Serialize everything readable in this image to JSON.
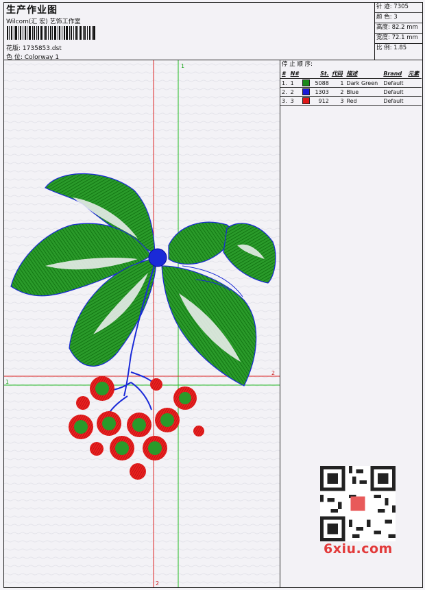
{
  "header": {
    "title": "生产作业图",
    "company": "Wilcom(汇 宏) 艺饰工作室",
    "design_label": "花版:",
    "design_file": "1735853.dst",
    "colorway_label": "色 位:",
    "colorway": "Colorway 1"
  },
  "stats": [
    {
      "label": "针 迹:",
      "value": "7305"
    },
    {
      "label": "颜 色:",
      "value": "3"
    },
    {
      "label": "高度:",
      "value": "82.2 mm"
    },
    {
      "label": "宽度:",
      "value": "72.1 mm"
    },
    {
      "label": "比 例:",
      "value": "1.85"
    }
  ],
  "stop_sequence": {
    "title": "停 止 顺 序:",
    "columns": [
      "#",
      "N#",
      "St.",
      "代码",
      "描述",
      "Brand",
      "元素"
    ],
    "rows": [
      {
        "index": "1.",
        "n": "1",
        "stitches": "5088",
        "code": "1",
        "desc": "Dark Green",
        "brand": "Default",
        "color": "#1a8a1a"
      },
      {
        "index": "2.",
        "n": "2",
        "stitches": "1303",
        "code": "2",
        "desc": "Blue",
        "brand": "Default",
        "color": "#1a1ad8"
      },
      {
        "index": "3.",
        "n": "3",
        "stitches": "912",
        "code": "3",
        "desc": "Red",
        "brand": "Default",
        "color": "#e01818"
      }
    ]
  },
  "guides": {
    "v1": "1",
    "h1": "1",
    "h2": "2",
    "v2": "2"
  },
  "watermark": "6xiu.com",
  "colors": {
    "green_thread": "#1a8a1a",
    "blue_thread": "#1a2ad8",
    "red_thread": "#e01818",
    "guide_green": "#22bb22",
    "guide_red": "#dd2222"
  }
}
